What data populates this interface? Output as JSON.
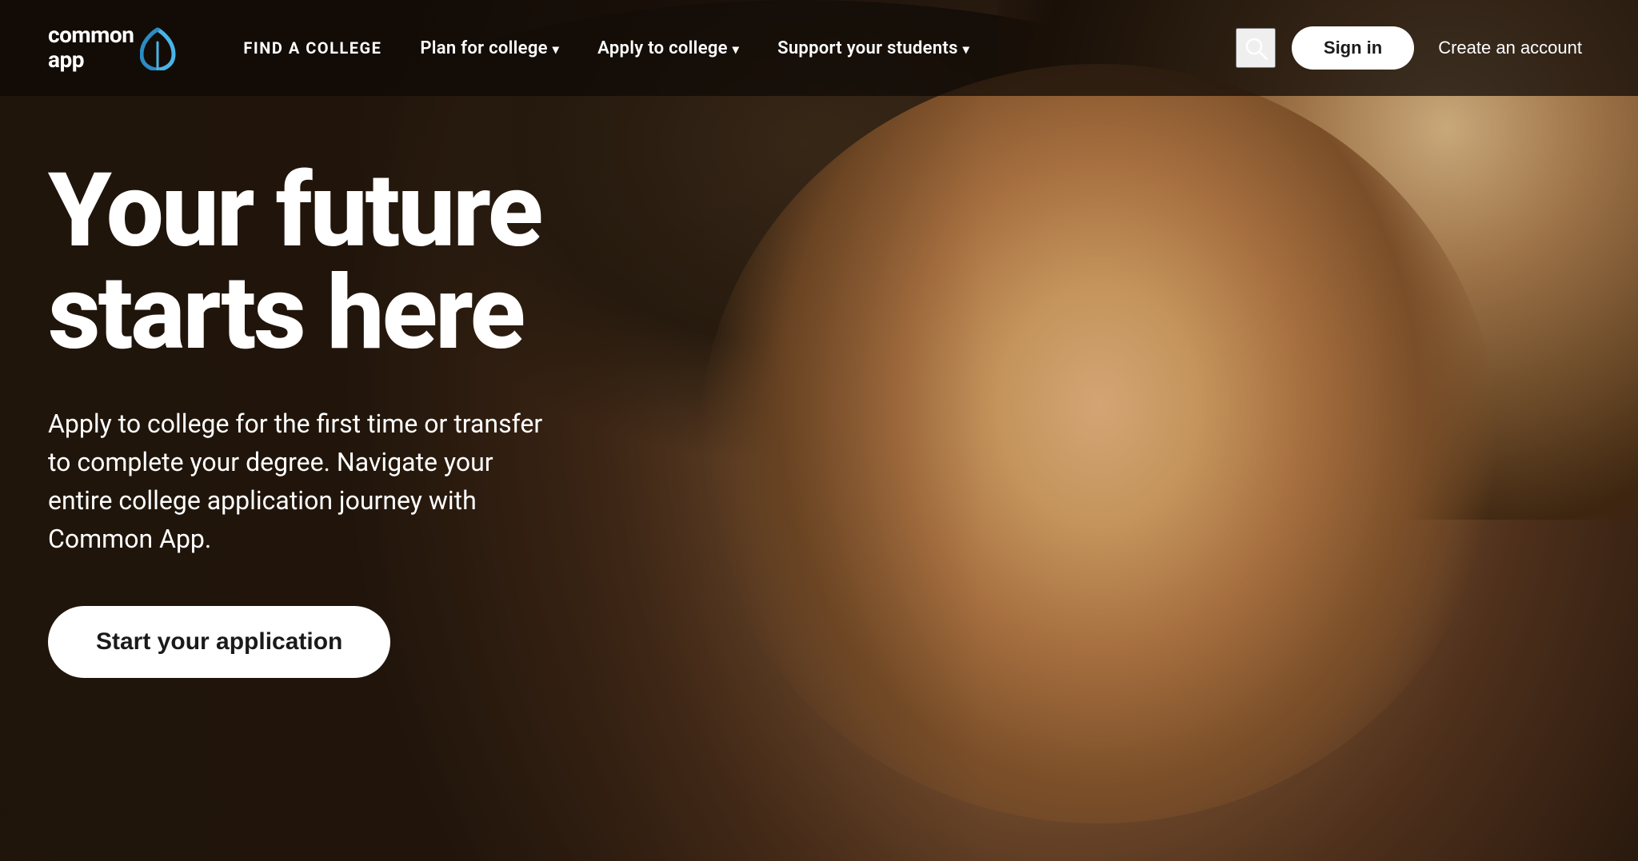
{
  "logo": {
    "line1": "common",
    "line2": "app"
  },
  "nav": {
    "find_college": "FIND A COLLEGE",
    "plan_for_college": "Plan for college",
    "apply_to_college": "Apply to college",
    "support_students": "Support your students"
  },
  "actions": {
    "signin_label": "Sign in",
    "create_account_label": "Create an account"
  },
  "hero": {
    "title_line1": "Your future",
    "title_line2": "starts here",
    "subtitle": "Apply to college for the first time or transfer to complete your degree. Navigate your entire college application journey with Common App.",
    "cta_label": "Start your application"
  }
}
